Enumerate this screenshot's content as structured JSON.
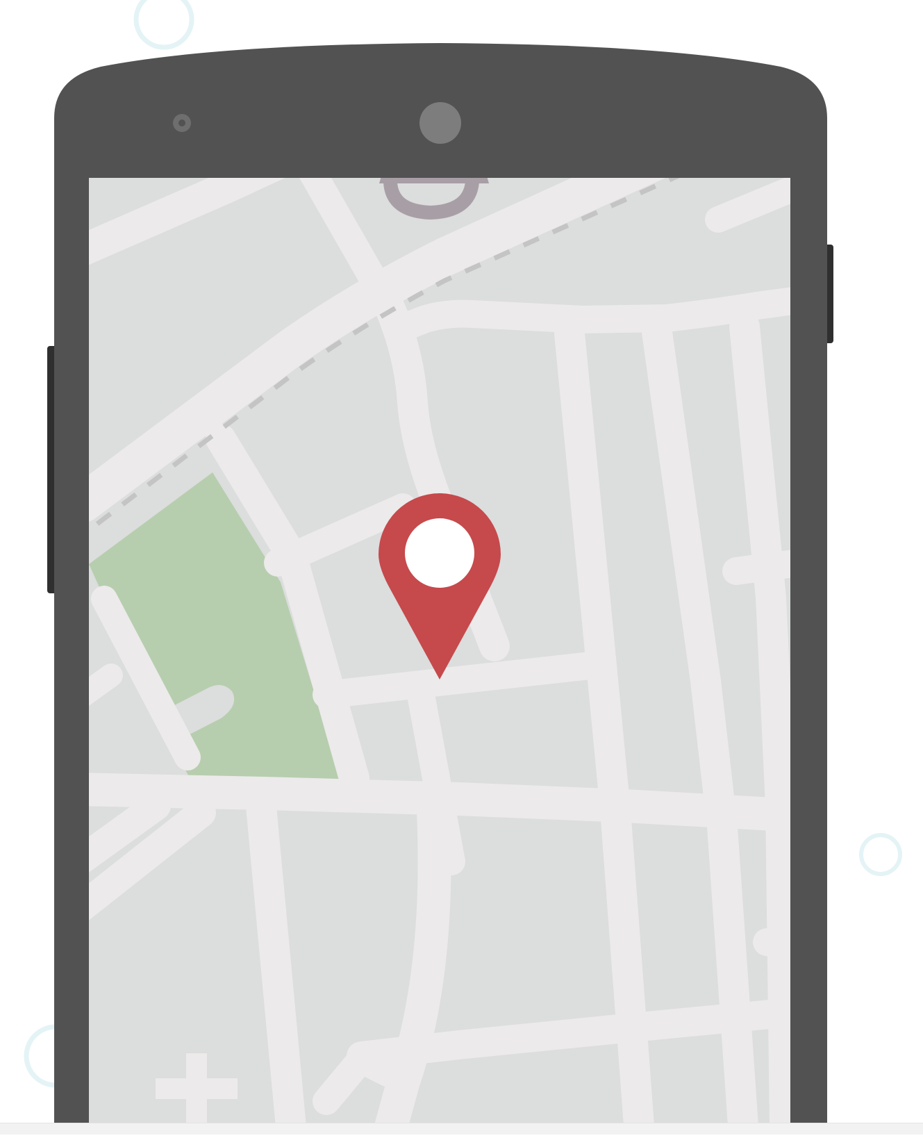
{
  "illustration": {
    "subject": "smartphone-map-location",
    "icons": {
      "pin": "map-pin-icon",
      "pin_dot": "pin-center-dot",
      "top_landmark": "location-marker-icon",
      "bottom_symbol": "plus-icon",
      "camera": "front-camera-icon",
      "speaker": "speaker-icon"
    },
    "colors": {
      "background": "#ffffff",
      "phone_body": "#525252",
      "side_buttons": "#2f2f2f",
      "camera": "#7d7d7d",
      "sensor": "#6e6e6e",
      "map_block": "#dcdddd",
      "road": "#eceaea",
      "park": "#b6ceae",
      "rail_dash": "#c4c4c4",
      "landmark": "#a89fa6",
      "pin": "#c6494c",
      "pin_dot": "#ffffff",
      "bubble_outline": "#e4f3f6"
    }
  }
}
